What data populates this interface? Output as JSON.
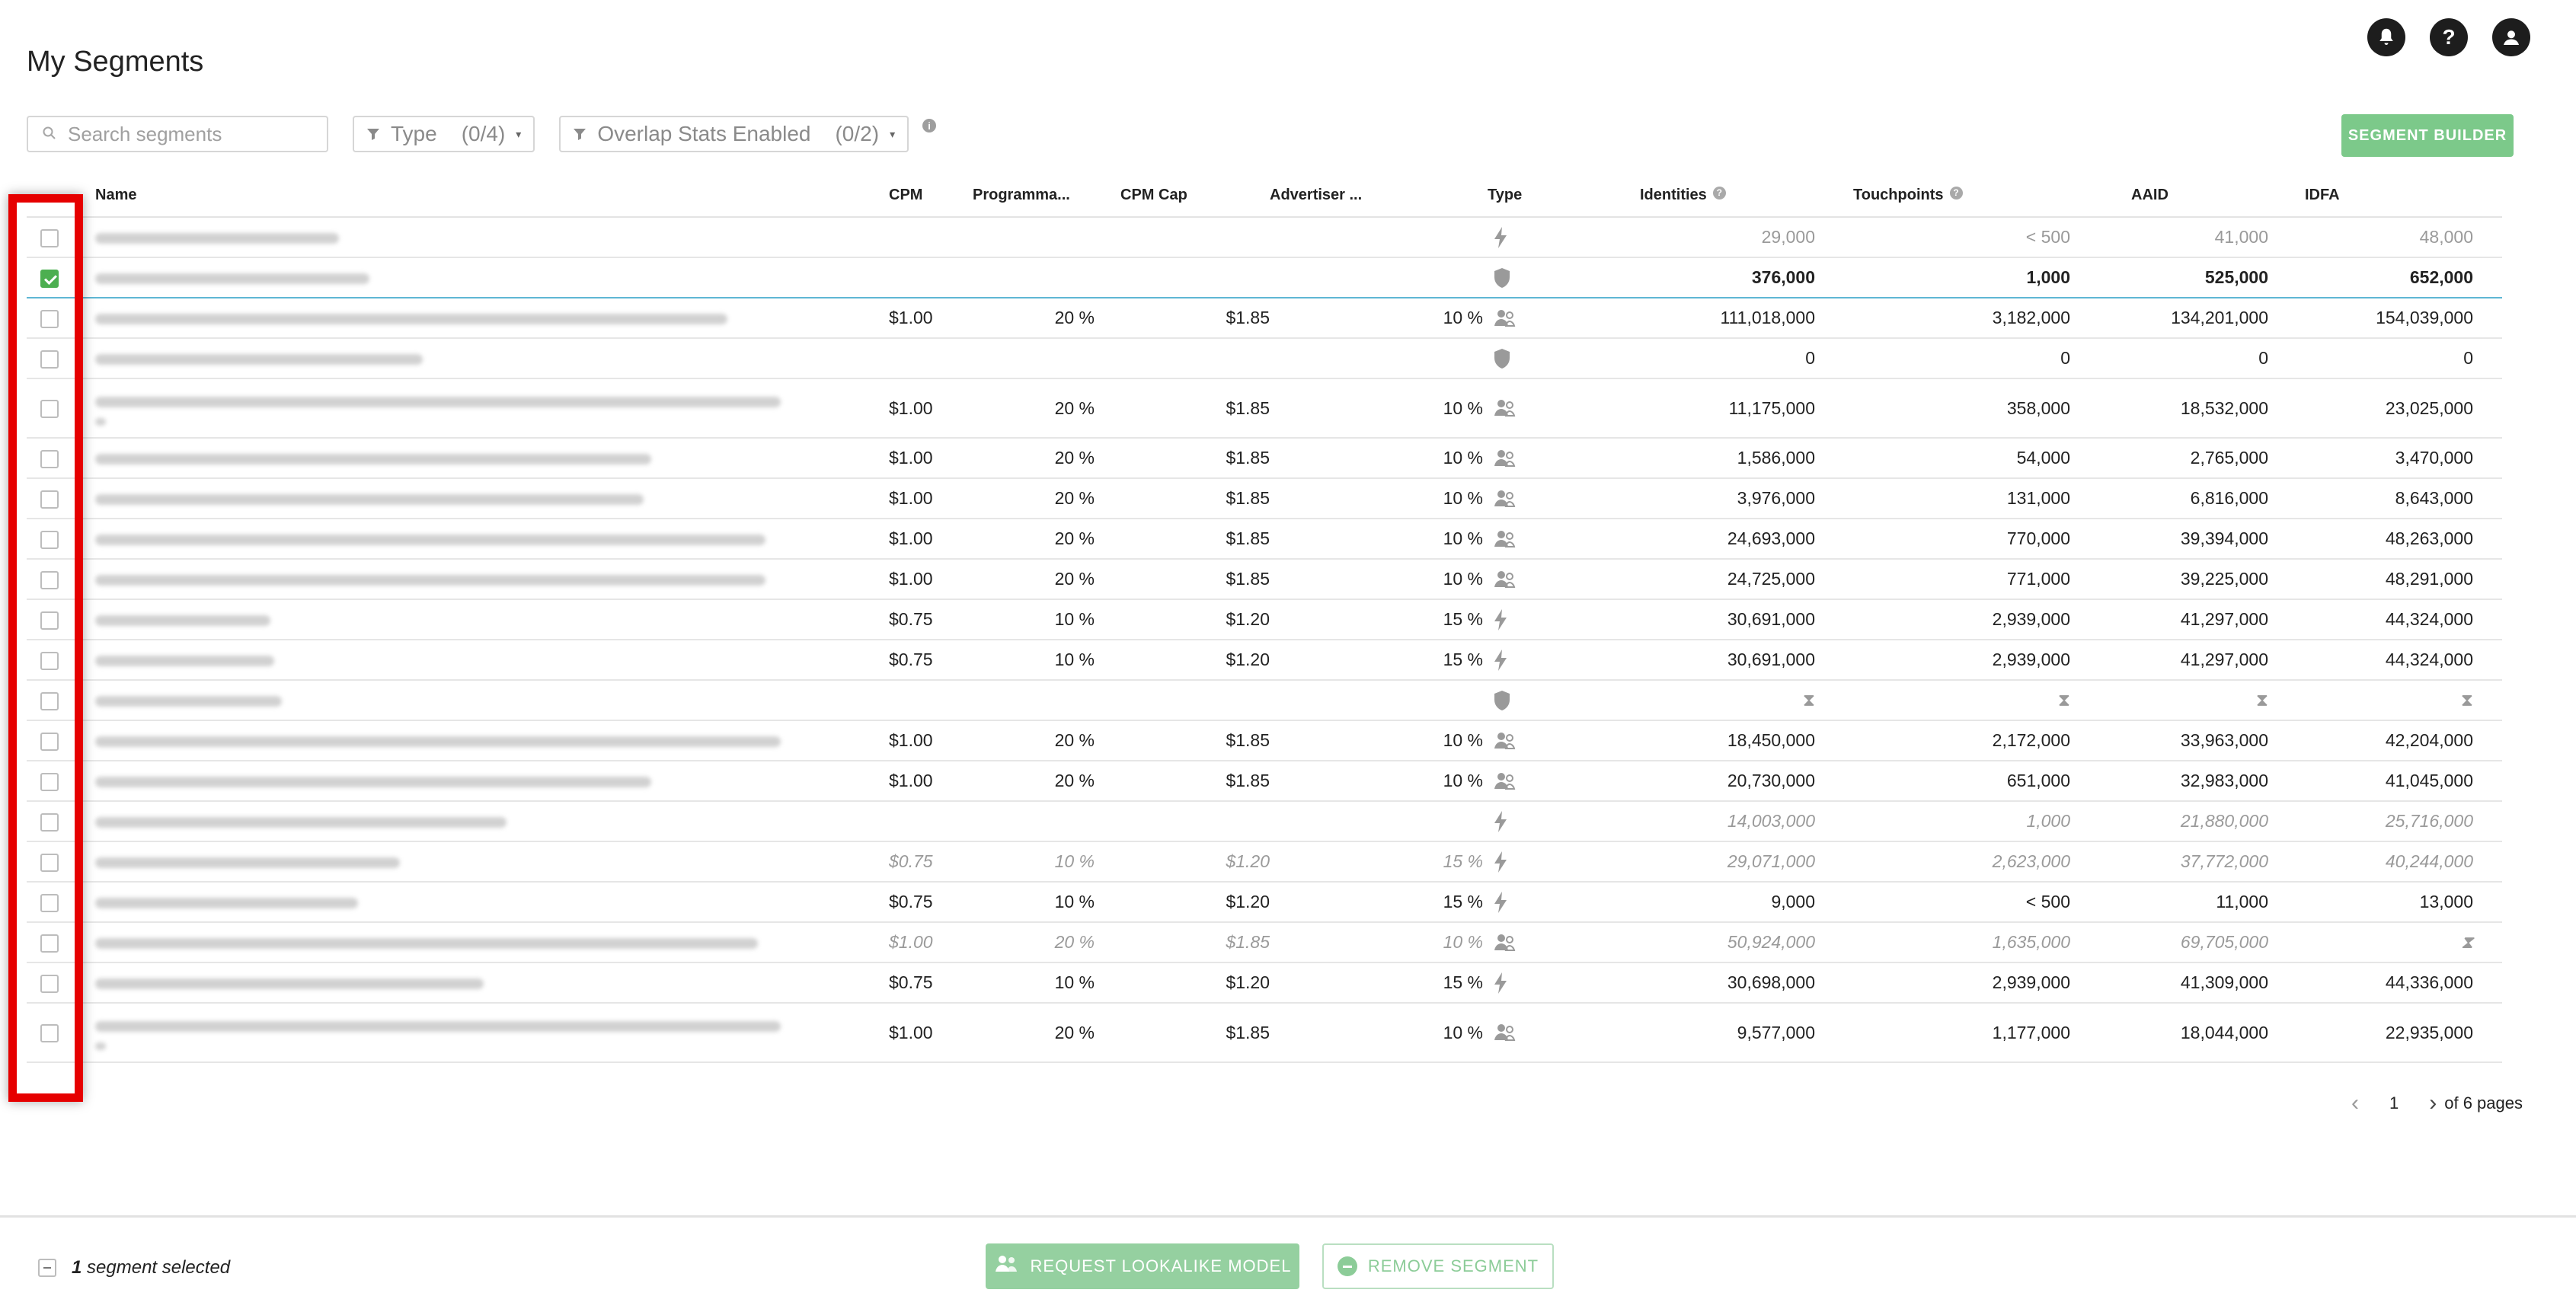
{
  "page": {
    "title": "My Segments"
  },
  "header_icons": [
    "bell-icon",
    "help-icon",
    "user-icon"
  ],
  "toolbar": {
    "search_placeholder": "Search segments",
    "type_filter": {
      "label": "Type",
      "count": "(0/4)"
    },
    "overlap_filter": {
      "label": "Overlap Stats Enabled",
      "count": "(0/2)"
    },
    "builder_label": "SEGMENT BUILDER"
  },
  "columns": {
    "name": "Name",
    "cpm": "CPM",
    "programmatic": "Programma...",
    "cpm_cap": "CPM Cap",
    "advertiser": "Advertiser ...",
    "type": "Type",
    "identities": "Identities",
    "touchpoints": "Touchpoints",
    "aaid": "AAID",
    "idfa": "IDFA"
  },
  "rows": [
    {
      "checked": false,
      "style": "dim",
      "tall": false,
      "name_w": 320,
      "cpm": "",
      "prog": "",
      "cap": "",
      "adv": "",
      "type": "bolt",
      "identities": "29,000",
      "touchpoints": "< 500",
      "aaid": "41,000",
      "idfa": "48,000"
    },
    {
      "checked": true,
      "style": "sel",
      "tall": false,
      "name_w": 360,
      "cpm": "",
      "prog": "",
      "cap": "",
      "adv": "",
      "type": "shield",
      "identities": "376,000",
      "touchpoints": "1,000",
      "aaid": "525,000",
      "idfa": "652,000"
    },
    {
      "checked": false,
      "style": "",
      "tall": false,
      "name_w": 830,
      "cpm": "$1.00",
      "prog": "20 %",
      "cap": "$1.85",
      "adv": "10 %",
      "type": "lookalike",
      "identities": "111,018,000",
      "touchpoints": "3,182,000",
      "aaid": "134,201,000",
      "idfa": "154,039,000"
    },
    {
      "checked": false,
      "style": "",
      "tall": false,
      "name_w": 430,
      "cpm": "",
      "prog": "",
      "cap": "",
      "adv": "",
      "type": "shield",
      "identities": "0",
      "touchpoints": "0",
      "aaid": "0",
      "idfa": "0"
    },
    {
      "checked": false,
      "style": "",
      "tall": true,
      "name_w": 900,
      "cpm": "$1.00",
      "prog": "20 %",
      "cap": "$1.85",
      "adv": "10 %",
      "type": "lookalike",
      "identities": "11,175,000",
      "touchpoints": "358,000",
      "aaid": "18,532,000",
      "idfa": "23,025,000"
    },
    {
      "checked": false,
      "style": "",
      "tall": false,
      "name_w": 730,
      "cpm": "$1.00",
      "prog": "20 %",
      "cap": "$1.85",
      "adv": "10 %",
      "type": "lookalike",
      "identities": "1,586,000",
      "touchpoints": "54,000",
      "aaid": "2,765,000",
      "idfa": "3,470,000"
    },
    {
      "checked": false,
      "style": "",
      "tall": false,
      "name_w": 720,
      "cpm": "$1.00",
      "prog": "20 %",
      "cap": "$1.85",
      "adv": "10 %",
      "type": "lookalike",
      "identities": "3,976,000",
      "touchpoints": "131,000",
      "aaid": "6,816,000",
      "idfa": "8,643,000"
    },
    {
      "checked": false,
      "style": "",
      "tall": false,
      "name_w": 880,
      "cpm": "$1.00",
      "prog": "20 %",
      "cap": "$1.85",
      "adv": "10 %",
      "type": "lookalike",
      "identities": "24,693,000",
      "touchpoints": "770,000",
      "aaid": "39,394,000",
      "idfa": "48,263,000"
    },
    {
      "checked": false,
      "style": "",
      "tall": false,
      "name_w": 880,
      "cpm": "$1.00",
      "prog": "20 %",
      "cap": "$1.85",
      "adv": "10 %",
      "type": "lookalike",
      "identities": "24,725,000",
      "touchpoints": "771,000",
      "aaid": "39,225,000",
      "idfa": "48,291,000"
    },
    {
      "checked": false,
      "style": "",
      "tall": false,
      "name_w": 230,
      "cpm": "$0.75",
      "prog": "10 %",
      "cap": "$1.20",
      "adv": "15 %",
      "type": "bolt",
      "identities": "30,691,000",
      "touchpoints": "2,939,000",
      "aaid": "41,297,000",
      "idfa": "44,324,000"
    },
    {
      "checked": false,
      "style": "",
      "tall": false,
      "name_w": 235,
      "cpm": "$0.75",
      "prog": "10 %",
      "cap": "$1.20",
      "adv": "15 %",
      "type": "bolt",
      "identities": "30,691,000",
      "touchpoints": "2,939,000",
      "aaid": "41,297,000",
      "idfa": "44,324,000"
    },
    {
      "checked": false,
      "style": "dim",
      "tall": false,
      "name_w": 245,
      "cpm": "",
      "prog": "",
      "cap": "",
      "adv": "",
      "type": "shield",
      "identities": "⧗",
      "touchpoints": "⧗",
      "aaid": "⧗",
      "idfa": "⧗"
    },
    {
      "checked": false,
      "style": "",
      "tall": false,
      "name_w": 900,
      "cpm": "$1.00",
      "prog": "20 %",
      "cap": "$1.85",
      "adv": "10 %",
      "type": "lookalike",
      "identities": "18,450,000",
      "touchpoints": "2,172,000",
      "aaid": "33,963,000",
      "idfa": "42,204,000"
    },
    {
      "checked": false,
      "style": "",
      "tall": false,
      "name_w": 730,
      "cpm": "$1.00",
      "prog": "20 %",
      "cap": "$1.85",
      "adv": "10 %",
      "type": "lookalike",
      "identities": "20,730,000",
      "touchpoints": "651,000",
      "aaid": "32,983,000",
      "idfa": "41,045,000"
    },
    {
      "checked": false,
      "style": "dim ital",
      "tall": false,
      "name_w": 540,
      "cpm": "",
      "prog": "",
      "cap": "",
      "adv": "",
      "type": "bolt",
      "identities": "14,003,000",
      "touchpoints": "1,000",
      "aaid": "21,880,000",
      "idfa": "25,716,000"
    },
    {
      "checked": false,
      "style": "dim ital",
      "tall": false,
      "name_w": 400,
      "cpm": "$0.75",
      "prog": "10 %",
      "cap": "$1.20",
      "adv": "15 %",
      "type": "bolt",
      "identities": "29,071,000",
      "touchpoints": "2,623,000",
      "aaid": "37,772,000",
      "idfa": "40,244,000"
    },
    {
      "checked": false,
      "style": "",
      "tall": false,
      "name_w": 345,
      "cpm": "$0.75",
      "prog": "10 %",
      "cap": "$1.20",
      "adv": "15 %",
      "type": "bolt",
      "identities": "9,000",
      "touchpoints": "< 500",
      "aaid": "11,000",
      "idfa": "13,000"
    },
    {
      "checked": false,
      "style": "dim ital",
      "tall": false,
      "name_w": 870,
      "cpm": "$1.00",
      "prog": "20 %",
      "cap": "$1.85",
      "adv": "10 %",
      "type": "lookalike",
      "identities": "50,924,000",
      "touchpoints": "1,635,000",
      "aaid": "69,705,000",
      "idfa": "⧗"
    },
    {
      "checked": false,
      "style": "",
      "tall": false,
      "name_w": 510,
      "cpm": "$0.75",
      "prog": "10 %",
      "cap": "$1.20",
      "adv": "15 %",
      "type": "bolt",
      "identities": "30,698,000",
      "touchpoints": "2,939,000",
      "aaid": "41,309,000",
      "idfa": "44,336,000"
    },
    {
      "checked": false,
      "style": "",
      "tall": true,
      "name_w": 900,
      "cpm": "$1.00",
      "prog": "20 %",
      "cap": "$1.85",
      "adv": "10 %",
      "type": "lookalike",
      "identities": "9,577,000",
      "touchpoints": "1,177,000",
      "aaid": "18,044,000",
      "idfa": "22,935,000"
    }
  ],
  "pagination": {
    "current": "1",
    "total_label": "of 6 pages"
  },
  "footer": {
    "count": "1",
    "selected_label": "segment selected",
    "lookalike_label": "REQUEST LOOKALIKE MODEL",
    "remove_label": "REMOVE SEGMENT"
  }
}
